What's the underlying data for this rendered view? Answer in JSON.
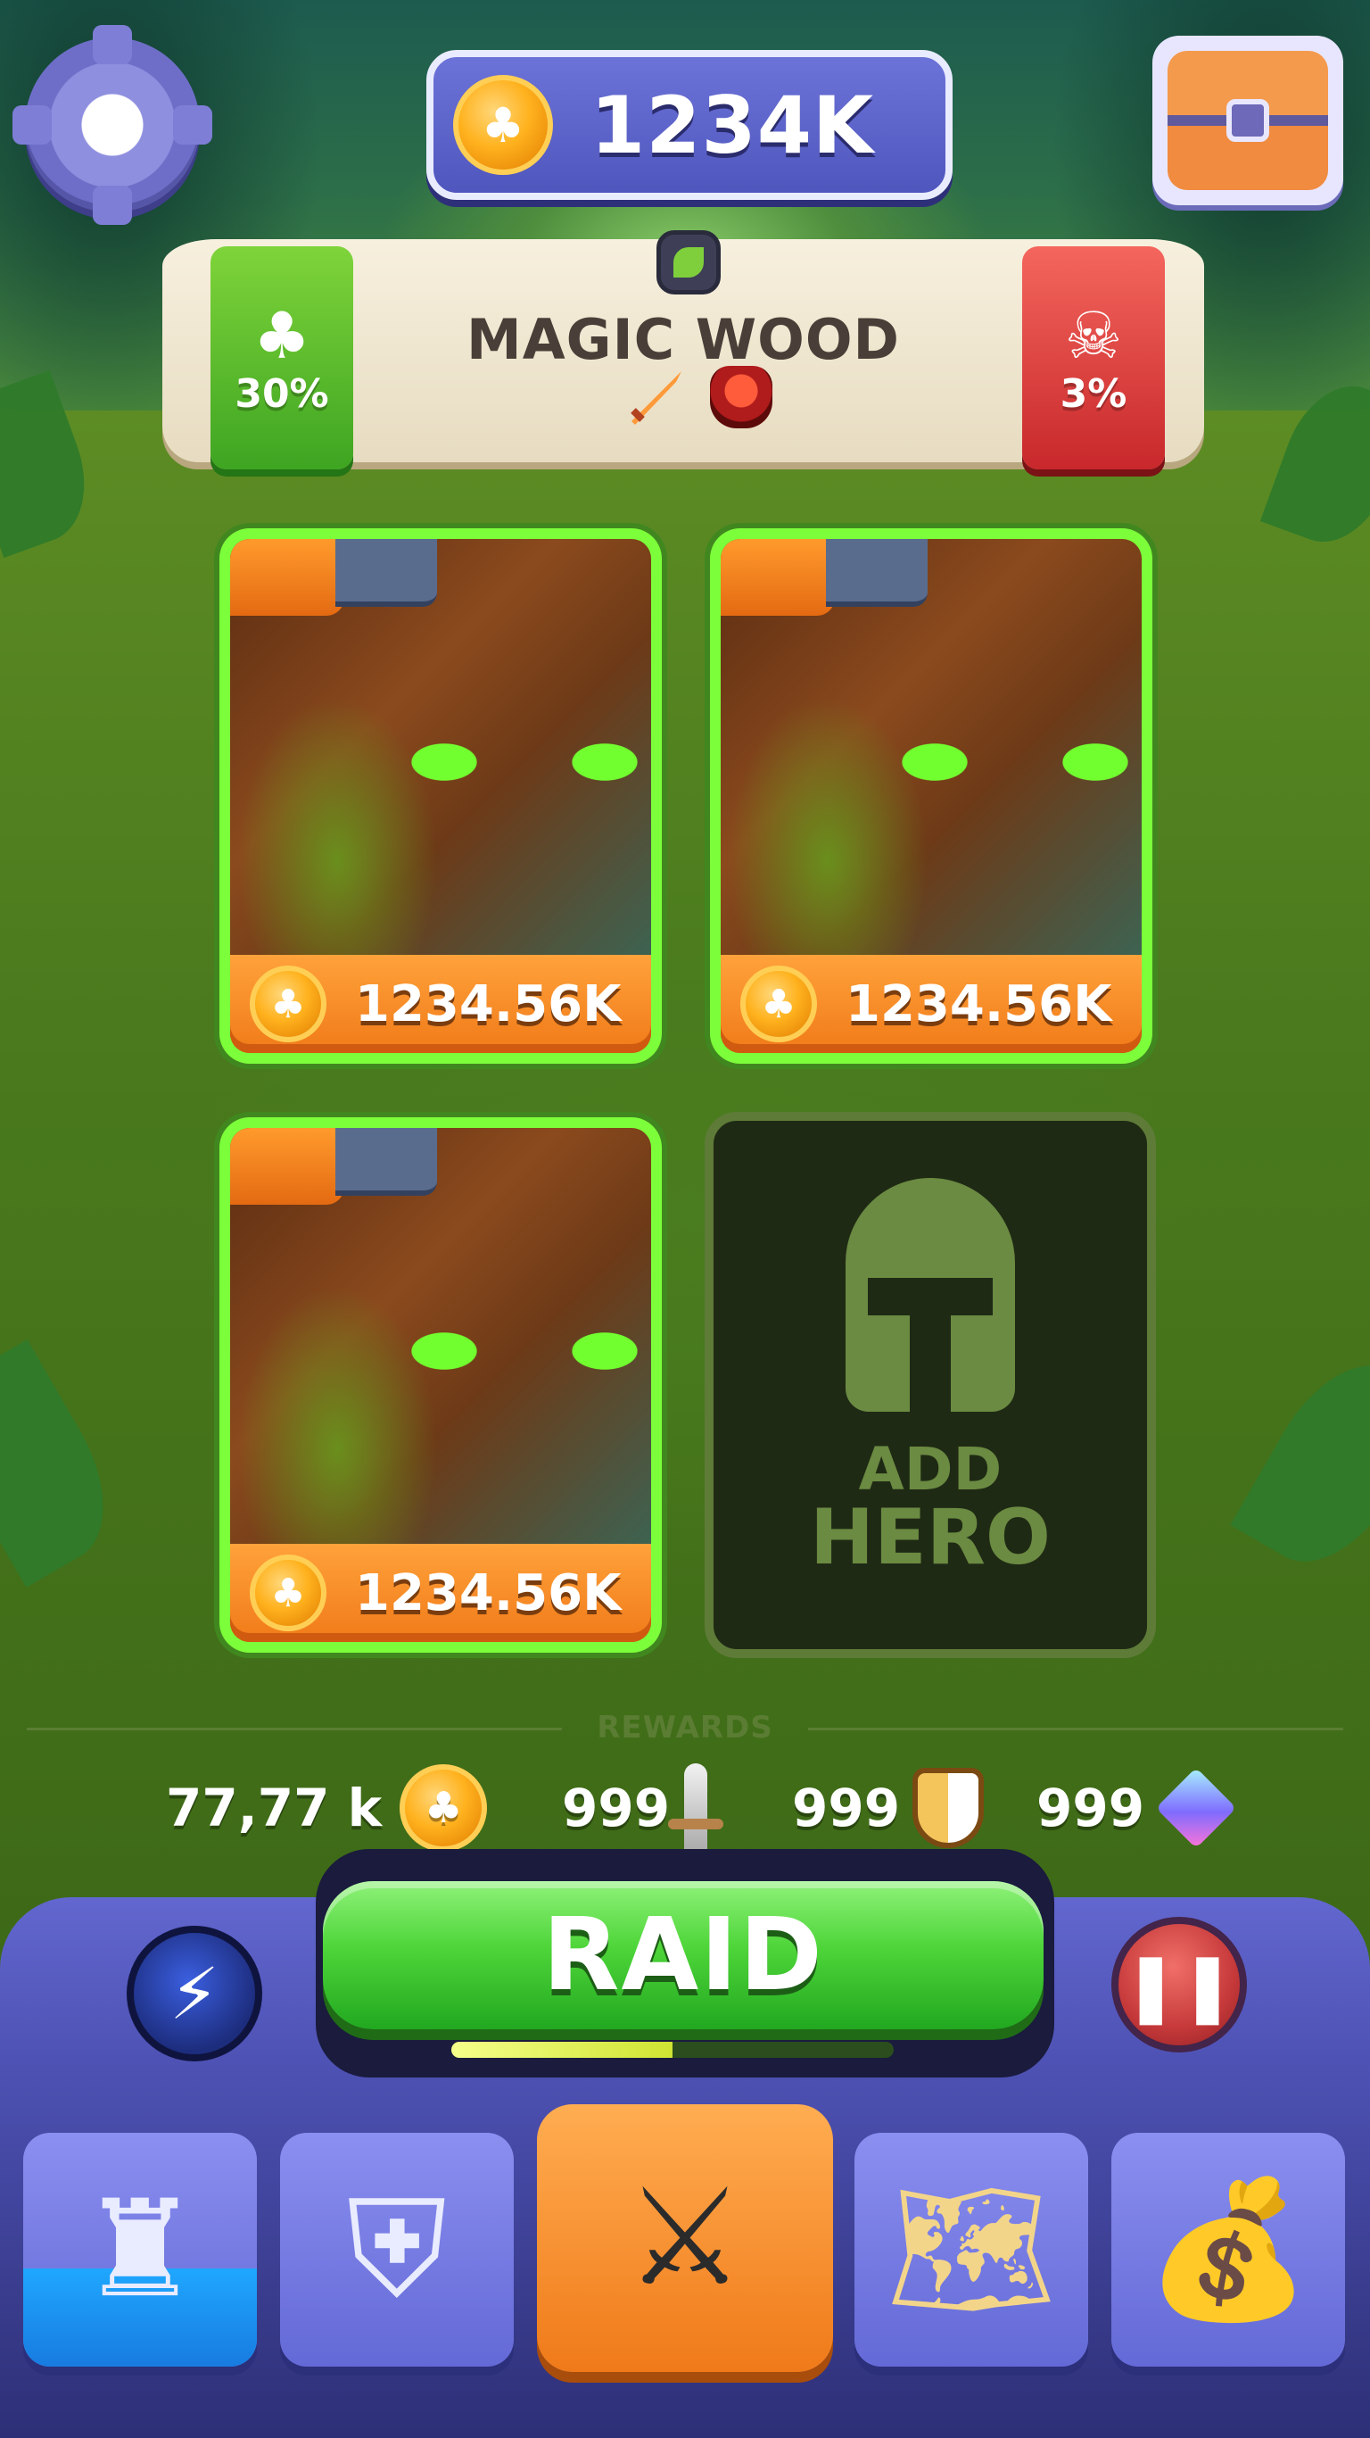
{
  "header": {
    "currency_value": "1234K",
    "currency_icon": "clover-coin-icon"
  },
  "location": {
    "title": "MAGIC WOOD",
    "bonus_left": "30%",
    "bonus_right": "3%",
    "left_icon": "clover-icon",
    "right_icon": "skull-icon",
    "biome_icon": "leaf-icon"
  },
  "heroes": [
    {
      "value": "1234.56K"
    },
    {
      "value": "1234.56K"
    },
    {
      "value": "1234.56K"
    }
  ],
  "add_hero": {
    "line1": "ADD",
    "line2": "HERO"
  },
  "rewards": {
    "title": "REWARDS",
    "coins": "77,77 k",
    "swords": "999",
    "shields": "999",
    "gems": "999"
  },
  "raid": {
    "label": "RAID",
    "progress": 0.5
  },
  "nav": [
    {
      "name": "castle"
    },
    {
      "name": "heroes"
    },
    {
      "name": "battle"
    },
    {
      "name": "map"
    },
    {
      "name": "shop"
    }
  ],
  "colors": {
    "accent_green": "#4ed539",
    "accent_orange": "#f07a19",
    "accent_purple": "#6369d6"
  }
}
